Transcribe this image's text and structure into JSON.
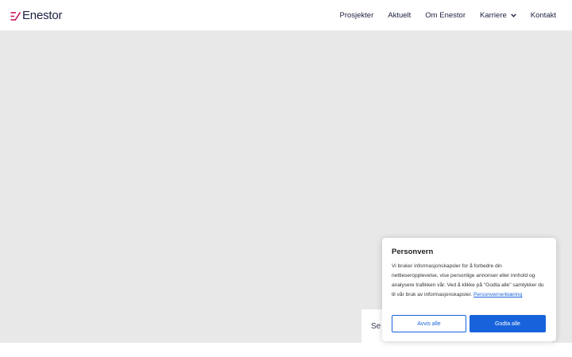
{
  "header": {
    "logo_text": "Enestor",
    "logo_icon": "enestor-logo-mark",
    "nav": [
      {
        "label": "Prosjekter"
      },
      {
        "label": "Aktuelt"
      },
      {
        "label": "Om Enestor"
      },
      {
        "label": "Karriere",
        "has_dropdown": true
      },
      {
        "label": "Kontakt"
      }
    ]
  },
  "behind_card": {
    "text": "Se"
  },
  "cookie_banner": {
    "title": "Personvern",
    "body": "Vi bruker informasjonskapsler for å forbedre din nettleseropplevelse, vise personlige annonser eller innhold og analysere trafikken vår. Ved å klikke på \"Godta alle\" samtykker du til vår bruk av informasjonskapsler.",
    "link_label": "Personvernerklæring",
    "reject_label": "Avvis alle",
    "accept_label": "Godta alle"
  },
  "colors": {
    "brand_accent": "#c8175d",
    "nav_text": "#1c2040",
    "button_blue": "#1863dc",
    "hero_bg": "#e8e8e8"
  }
}
